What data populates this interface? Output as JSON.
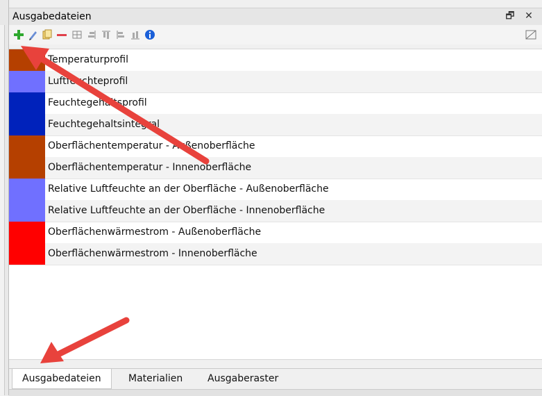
{
  "panel": {
    "title": "Ausgabedateien"
  },
  "titlebar": {
    "float_glyph": "🗗",
    "close_glyph": "✕"
  },
  "colors": {
    "brown": "#B54000",
    "lavender": "#7070FF",
    "navy": "#0022BB",
    "red": "#FF0000",
    "arrow": "#E8423C"
  },
  "list": {
    "items": [
      {
        "label": "Temperaturprofil",
        "color": "#B54000"
      },
      {
        "label": "Luftfeuchteprofil",
        "color": "#7070FF"
      },
      {
        "label": "Feuchtegehaltsprofil",
        "color": "#0022BB"
      },
      {
        "label": "Feuchtegehaltsintegral",
        "color": "#0022BB"
      },
      {
        "label": "Oberflächentemperatur - Außenoberfläche",
        "color": "#B54000"
      },
      {
        "label": "Oberflächentemperatur - Innenoberfläche",
        "color": "#B54000"
      },
      {
        "label": "Relative Luftfeuchte an der Oberfläche - Außenoberfläche",
        "color": "#7070FF"
      },
      {
        "label": "Relative Luftfeuchte an der Oberfläche - Innenoberfläche",
        "color": "#7070FF"
      },
      {
        "label": "Oberflächenwärmestrom - Außenoberfläche",
        "color": "#FF0000"
      },
      {
        "label": "Oberflächenwärmestrom - Innenoberfläche",
        "color": "#FF0000"
      }
    ]
  },
  "tabs": [
    {
      "label": "Ausgabedateien",
      "active": true
    },
    {
      "label": "Materialien",
      "active": false
    },
    {
      "label": "Ausgaberaster",
      "active": false
    }
  ],
  "toolbar": {
    "icons": [
      "add-icon",
      "edit-icon",
      "copy-icon",
      "remove-icon",
      "grid-icon",
      "align-right-icon",
      "align-top-icon",
      "align-left-icon",
      "align-bottom-icon",
      "info-icon"
    ]
  }
}
